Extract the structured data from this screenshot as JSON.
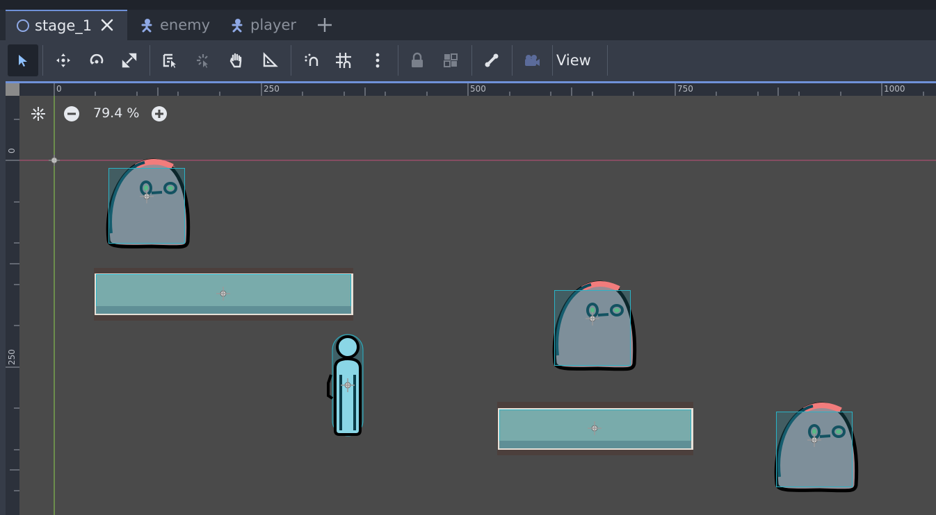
{
  "tabs": [
    {
      "label": "stage_1",
      "active": true
    },
    {
      "label": "enemy",
      "active": false
    },
    {
      "label": "player",
      "active": false
    }
  ],
  "toolbar": {
    "tools": [
      "select-mode-icon",
      "move-mode-icon",
      "rotate-mode-icon",
      "scale-mode-icon",
      "list-select-icon",
      "pivot-icon",
      "pan-mode-icon",
      "ruler-icon",
      "smart-snap-icon",
      "grid-snap-icon",
      "more-options-icon",
      "lock-icon",
      "group-icon",
      "skeleton-icon",
      "camera-override-icon"
    ],
    "view_label": "View"
  },
  "ruler": {
    "top_labels": [
      "0",
      "250",
      "500",
      "750",
      "1000"
    ],
    "left_labels": [
      "0",
      "250"
    ]
  },
  "zoom": {
    "value": "79.4 %"
  },
  "colors": {
    "accent": "#6f91d8",
    "origin_line_h": "#c0507a",
    "origin_line_v": "#8fd050",
    "collision": "#2ab3c6"
  }
}
